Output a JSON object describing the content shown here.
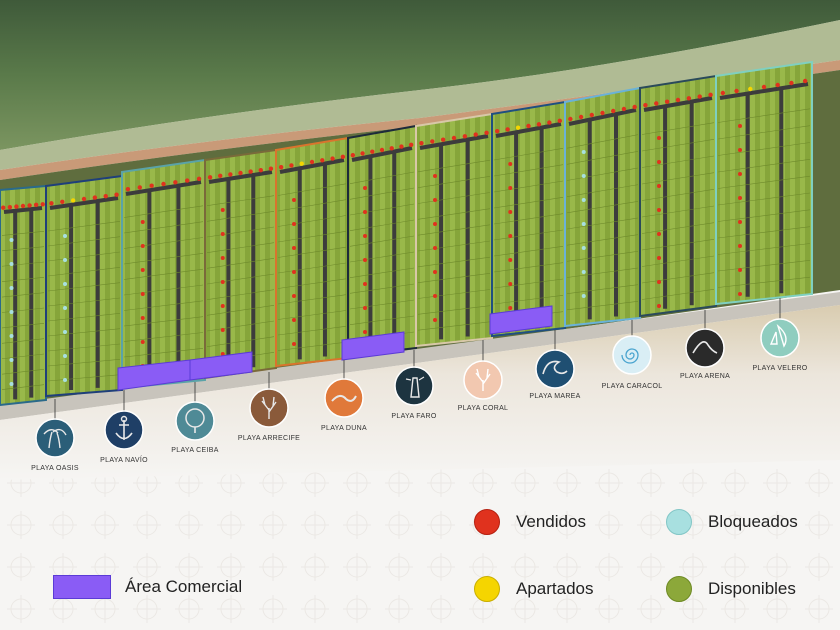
{
  "colors": {
    "vendidos": "#e0321e",
    "bloqueados": "#a8e0e0",
    "apartados": "#f5d500",
    "disponibles": "#8ca83a",
    "area_comercial": "#8a5cf5"
  },
  "segments": [
    {
      "key": "oasis",
      "label": "PLAYA OASIS",
      "icon": "palm-trees-icon",
      "icon_bg": "#2b5e78",
      "border": "#2a6a8a"
    },
    {
      "key": "navio",
      "label": "PLAYA NAVÍO",
      "icon": "anchor-icon",
      "icon_bg": "#1f3f66",
      "border": "#1f3f7a"
    },
    {
      "key": "ceiba",
      "label": "PLAYA CEIBA",
      "icon": "tree-icon",
      "icon_bg": "#4f8a96",
      "border": "#5aa3a8"
    },
    {
      "key": "arrecife",
      "label": "PLAYA ARRECIFE",
      "icon": "coral-reef-icon",
      "icon_bg": "#8a5a3a",
      "border": "#7a6a3a"
    },
    {
      "key": "duna",
      "label": "PLAYA DUNA",
      "icon": "dune-icon",
      "icon_bg": "#e0793a",
      "border": "#d9742d"
    },
    {
      "key": "faro",
      "label": "PLAYA FARO",
      "icon": "lighthouse-icon",
      "icon_bg": "#1d3440",
      "border": "#1d2b3a"
    },
    {
      "key": "coral",
      "label": "PLAYA CORAL",
      "icon": "coral-icon",
      "icon_bg": "#f2c8b0",
      "border": "#d8c8a8"
    },
    {
      "key": "marea",
      "label": "PLAYA MAREA",
      "icon": "wave-icon",
      "icon_bg": "#1f4f72",
      "border": "#1f4f80"
    },
    {
      "key": "caracol",
      "label": "PLAYA CARACOL",
      "icon": "shell-icon",
      "icon_bg": "#d9eef5",
      "border": "#6ab2d8"
    },
    {
      "key": "arena",
      "label": "PLAYA ARENA",
      "icon": "sand-icon",
      "icon_bg": "#2a2a2a",
      "border": "#2a4a5a"
    },
    {
      "key": "velero",
      "label": "PLAYA VELERO",
      "icon": "sailboat-icon",
      "icon_bg": "#8fcdbf",
      "border": "#7fd0c0"
    }
  ],
  "legend": {
    "vendidos": "Vendidos",
    "bloqueados": "Bloqueados",
    "apartados": "Apartados",
    "disponibles": "Disponibles",
    "area_comercial": "Área Comercial"
  }
}
